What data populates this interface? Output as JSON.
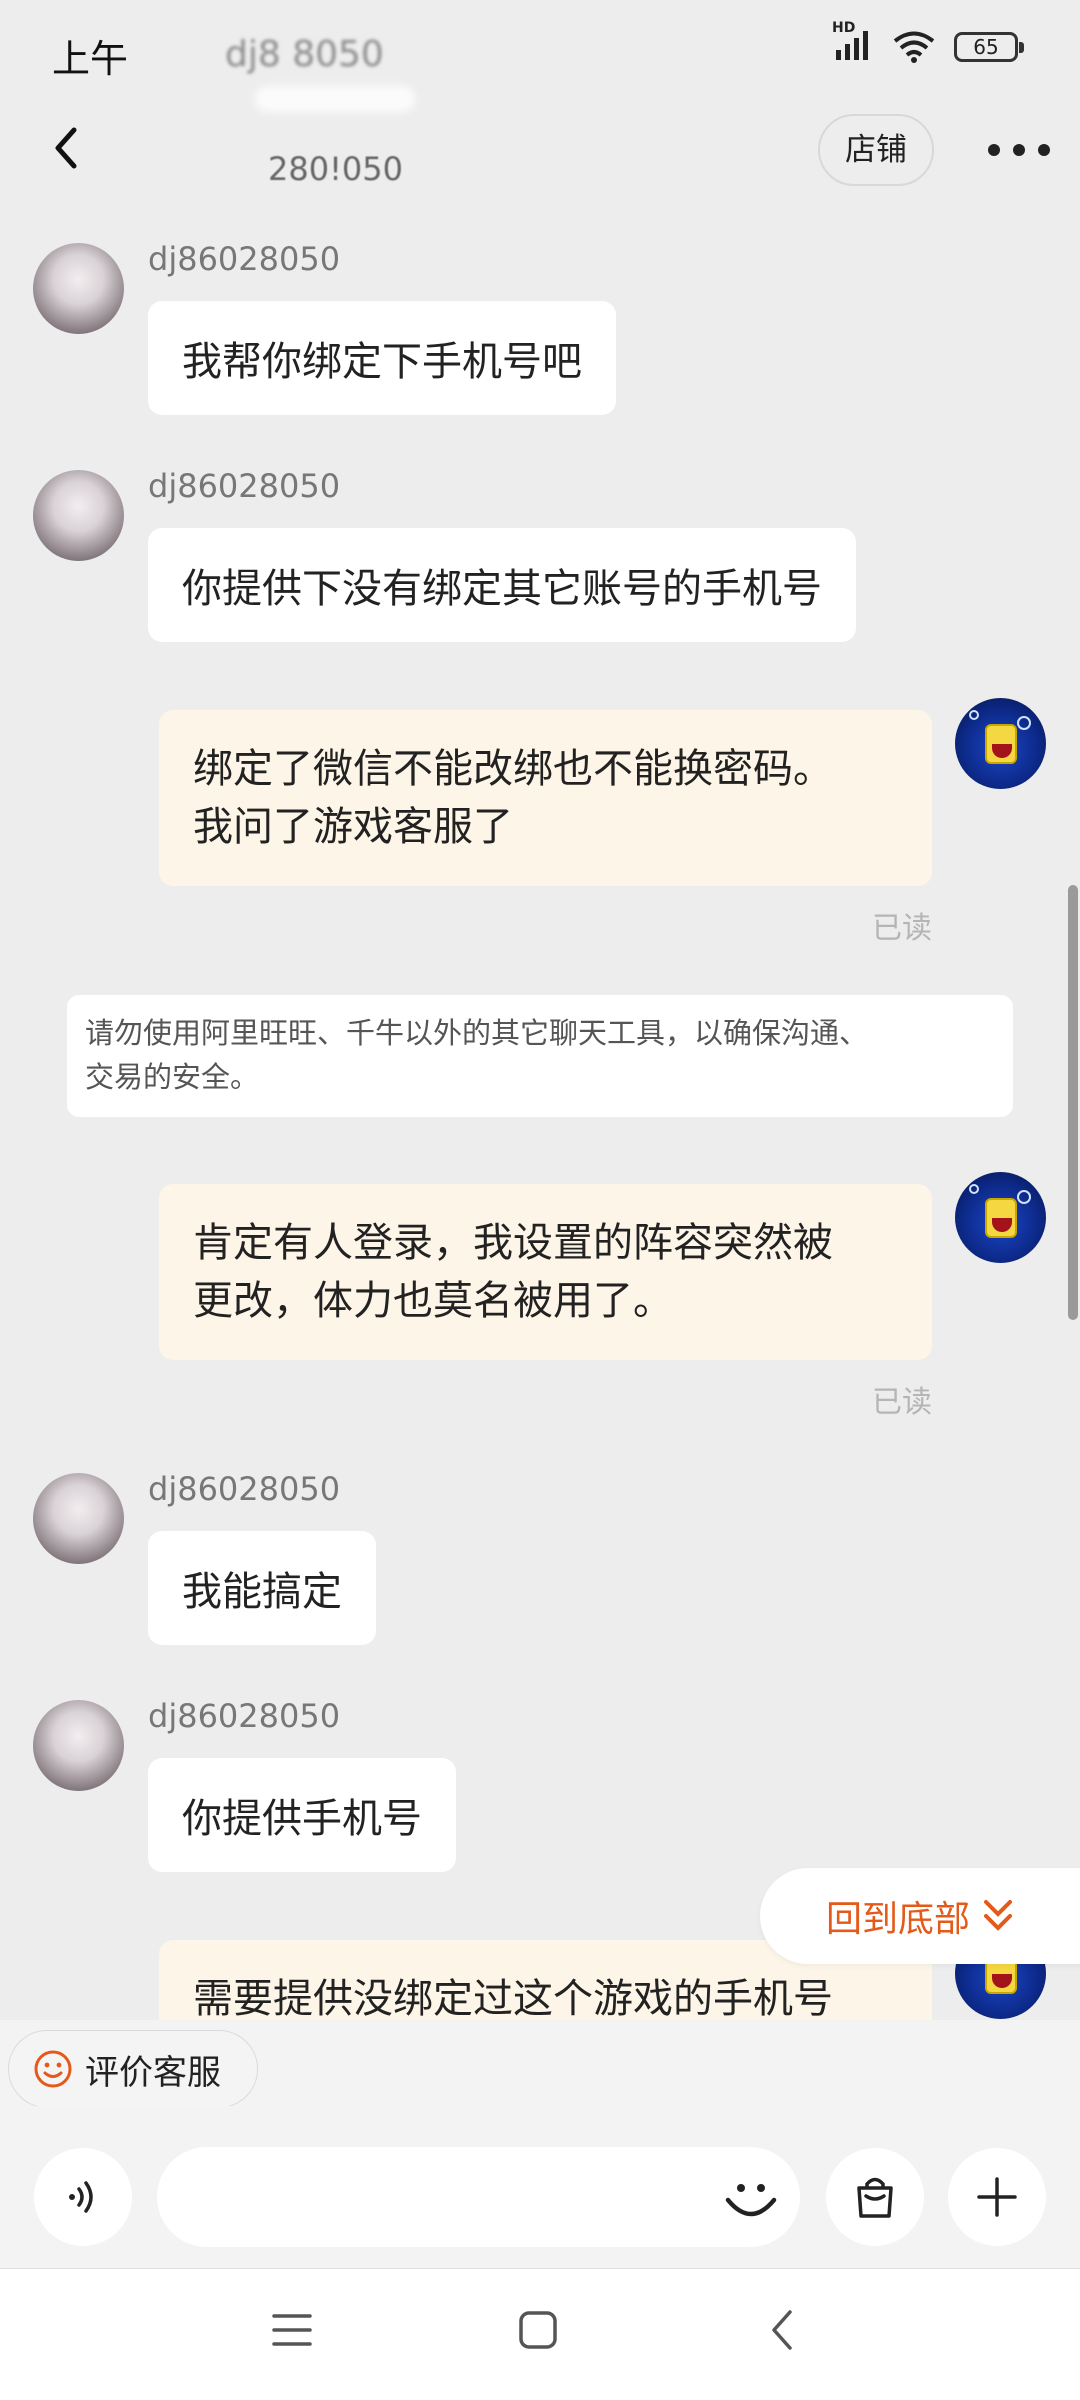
{
  "status_bar": {
    "time": "上午",
    "blurred_text": "dj8   8050",
    "signal_label": "HD",
    "battery": "65"
  },
  "header": {
    "subtitle": "280!050",
    "shop_label": "店铺"
  },
  "messages": [
    {
      "side": "left",
      "sender": "dj86028050",
      "text": "我帮你绑定下手机号吧"
    },
    {
      "side": "left",
      "sender": "dj86028050",
      "text": "你提供下没有绑定其它账号的手机号"
    },
    {
      "side": "right",
      "lines": [
        "绑定了微信不能改绑也不能换密码。",
        "我问了游戏客服了"
      ],
      "status": "已读"
    },
    {
      "side": "right",
      "lines": [
        "肯定有人登录，我设置的阵容突然被",
        "更改，体力也莫名被用了。"
      ],
      "status": "已读"
    },
    {
      "side": "left",
      "sender": "dj86028050",
      "text": "我能搞定"
    },
    {
      "side": "left",
      "sender": "dj86028050",
      "text": "你提供手机号"
    },
    {
      "side": "right",
      "lines": [
        "需要提供没绑定过这个游戏的手机号"
      ]
    }
  ],
  "notice": {
    "line1": "请勿使用阿里旺旺、千牛以外的其它聊天工具，以确保沟通、",
    "line2": "交易的安全。"
  },
  "jump_to_bottom_label": "回到底部",
  "evaluate_label": "评价客服",
  "input": {
    "placeholder": ""
  },
  "colors": {
    "background": "#ededed",
    "own_bubble": "#fdf5e7",
    "accent": "#e35a1a"
  },
  "icons": [
    "back-arrow-icon",
    "more-icon",
    "voice-icon",
    "emoji-icon",
    "shop-bag-icon",
    "plus-icon",
    "smile-icon",
    "double-chevron-down-icon",
    "menu-icon",
    "home-icon",
    "back-nav-icon"
  ]
}
